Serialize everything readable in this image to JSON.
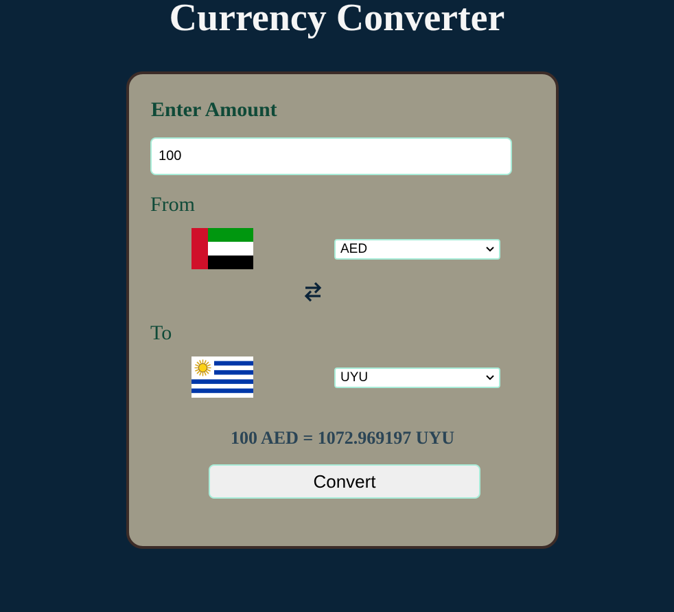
{
  "page": {
    "title": "Currency Converter"
  },
  "colors": {
    "background": "#0a2338",
    "card_background": "#9e9a88",
    "card_border": "#3c2c28",
    "label_green": "#0f4a38",
    "input_border": "#a8ecd8",
    "result_text": "#2b4556"
  },
  "converter": {
    "amount_heading": "Enter Amount",
    "amount_value": "100",
    "from_label": "From",
    "from_currency": "AED",
    "from_flag": "uae-flag",
    "swap_icon": "swap-arrows-icon",
    "to_label": "To",
    "to_currency": "UYU",
    "to_flag": "uruguay-flag",
    "result": "100 AED = 1072.969197 UYU",
    "convert_label": "Convert"
  }
}
